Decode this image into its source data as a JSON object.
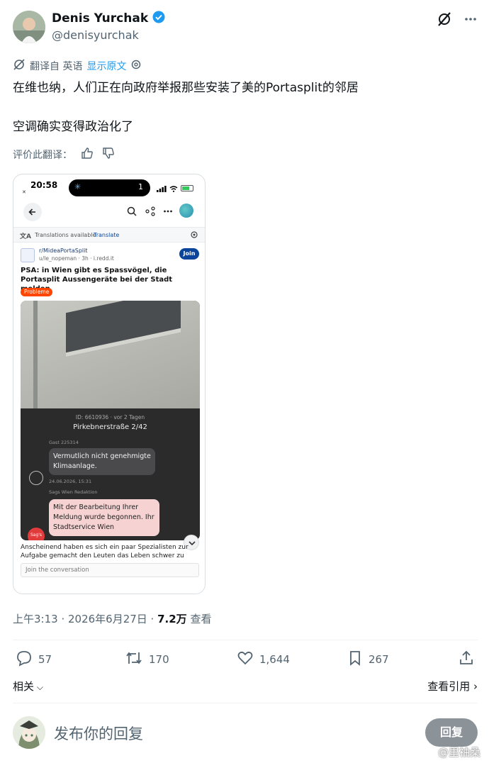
{
  "author": {
    "display_name": "Denis Yurchak",
    "handle": "@denisyurchak"
  },
  "translation": {
    "translated_from": "翻译自 英语",
    "show_original": "显示原文",
    "rate_label": "评价此翻译："
  },
  "tweet": {
    "line1": "在维也纳，人们正在向政府举报那些安装了美的Portasplit的邻居",
    "line2": "空调确实变得政治化了"
  },
  "embedded_screenshot": {
    "status_time": "20:58",
    "island_count": "1",
    "translations_text": "Translations available",
    "translate_link": "Translate",
    "subreddit": "r/MideaPortaSplit",
    "user_meta": "u/le_nopeman · 3h · i.redd.it",
    "join_label": "Join",
    "post_title": "PSA: in Wien gibt es Spassvögel, die Portasplit Aussengeräte bei der Stadt melden",
    "flair": "Probleme",
    "image_id": "ID: 6610936 · vor 2 Tagen",
    "image_address": "Pirkebnerstraße 2/42",
    "guest_label": "Gast 225314",
    "guest_message": "Vermutlich nicht genehmigte Klimaanlage.",
    "message_date": "24.06.2026, 15:31",
    "redaktion_label": "Sags Wien Redaktion",
    "redaktion_message": "Mit der Bearbeitung Ihrer Meldung wurde begonnen. Ihr Stadtservice Wien",
    "badge_text": "Sag's",
    "post_body": "Anscheinend haben es sich ein paar Spezialisten zur Aufgabe gemacht den Leuten das Leben schwer zu",
    "join_placeholder": "Join the conversation"
  },
  "meta": {
    "time_date": "上午3:13 · 2026年6月27日 · ",
    "views": "7.2万",
    "views_label": " 查看"
  },
  "actions": {
    "replies": "57",
    "reposts": "170",
    "likes": "1,644",
    "bookmarks": "267"
  },
  "related": {
    "related_label": "相关",
    "quotes_label": "查看引用"
  },
  "reply": {
    "placeholder": "发布你的回复",
    "button": "回复"
  },
  "watermark": "@里袖桑",
  "colors": {
    "accent": "#1d9bf0",
    "verified": "#1d9bf0",
    "text_secondary": "#536471",
    "reddit_join": "#0a449b",
    "flair": "#ff4500"
  }
}
